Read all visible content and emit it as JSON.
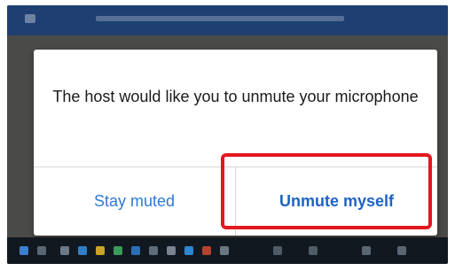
{
  "dialog": {
    "message": "The host would like you to unmute your microphone",
    "stay_muted_label": "Stay muted",
    "unmute_label": "Unmute myself"
  },
  "colors": {
    "link_blue": "#2d7ad6",
    "highlight_red": "#e3171e",
    "backdrop": "#4a4a48",
    "taskbar": "#121820"
  },
  "icons": {
    "taskbar": [
      "start-icon",
      "search-icon",
      "app-icon",
      "app-icon",
      "app-icon",
      "app-icon",
      "app-icon",
      "app-icon",
      "app-icon",
      "app-icon",
      "app-icon",
      "app-icon",
      "app-icon",
      "app-icon",
      "app-icon",
      "app-icon"
    ]
  }
}
